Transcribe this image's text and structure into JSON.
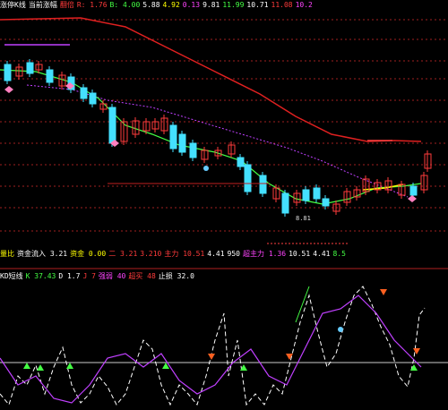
{
  "top_legend": [
    {
      "text": "涨停K线",
      "color": "#ffffff"
    },
    {
      "text": "当前涨幅",
      "color": "#ffffff"
    },
    {
      "text": "翻倍",
      "color": "#ff3b3b"
    },
    {
      "text": "R: 1.76",
      "color": "#ff3b3b"
    },
    {
      "text": "B: 4.00",
      "color": "#44ff44"
    },
    {
      "text": "5.88",
      "color": "#ffffff"
    },
    {
      "text": "4.92",
      "color": "#ffff00"
    },
    {
      "text": "0.13",
      "color": "#ff44ff"
    },
    {
      "text": "9.81",
      "color": "#ffffff"
    },
    {
      "text": "11.99",
      "color": "#44ff44"
    },
    {
      "text": "10.71",
      "color": "#ffffff"
    },
    {
      "text": "11.08",
      "color": "#ff3b3b"
    },
    {
      "text": "10.2",
      "color": "#ff44ff"
    }
  ],
  "mid_legend": [
    {
      "text": "量比",
      "color": "#ffff00"
    },
    {
      "text": "资金流入 3.21",
      "color": "#ffffff"
    },
    {
      "text": "资金 0.00",
      "color": "#ffff00"
    },
    {
      "text": "二 3.21",
      "color": "#ff3b3b"
    },
    {
      "text": "3.210",
      "color": "#ff3b3b"
    },
    {
      "text": "主力 10.51",
      "color": "#ff3b3b"
    },
    {
      "text": "4.41",
      "color": "#ffffff"
    },
    {
      "text": "950",
      "color": "#ffffff"
    },
    {
      "text": "超主力 1.36",
      "color": "#ff44ff"
    },
    {
      "text": "10.51",
      "color": "#ffffff"
    },
    {
      "text": "4.41",
      "color": "#ffffff"
    },
    {
      "text": "8.5",
      "color": "#44ff44"
    }
  ],
  "low_legend": [
    {
      "text": "KD短线",
      "color": "#ffffff"
    },
    {
      "text": "K 37.43",
      "color": "#44ff44"
    },
    {
      "text": "D 1.7",
      "color": "#ffffff"
    },
    {
      "text": "J 7",
      "color": "#ff3b3b"
    },
    {
      "text": "强弱 40",
      "color": "#ff44ff"
    },
    {
      "text": "超买 48",
      "color": "#ff3b3b"
    },
    {
      "text": "止损 32.0",
      "color": "#ffffff"
    }
  ],
  "price_markers": {
    "low_price_label": "8.81"
  },
  "colors": {
    "background": "#000000",
    "up": "#ff3b3b",
    "down": "#44e0ff",
    "ma_long": "#e02020",
    "ma_mid": "#44ff44",
    "ma_slow": "#c040ff",
    "grid": "#a02020"
  }
}
